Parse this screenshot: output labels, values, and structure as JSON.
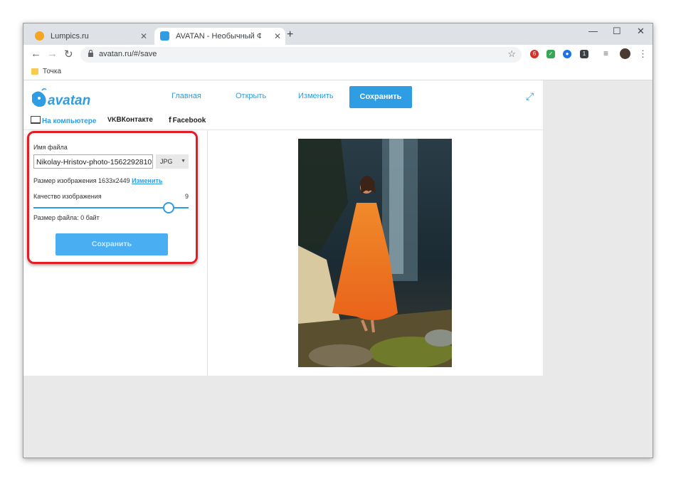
{
  "browser": {
    "tabs": [
      {
        "title": "Lumpics.ru",
        "favicon_color": "#f4a623",
        "close": "✕"
      },
      {
        "title": "AVATAN - Необычный Фоторедактор",
        "favicon_color": "#2e9de3",
        "close": "✕"
      }
    ],
    "new_tab": "+",
    "window_controls": {
      "minimize": "—",
      "maximize": "☐",
      "close": "✕"
    },
    "nav": {
      "back": "←",
      "forward": "→",
      "reload": "↻"
    },
    "address": {
      "url": "avatan.ru/#/save",
      "lock": "🔒",
      "star": "☆"
    },
    "extensions": [
      {
        "icon": "opera-icon",
        "color": "#d93025",
        "badge": "6"
      },
      {
        "icon": "check-icon",
        "color": "#34a853",
        "badge": "✓"
      },
      {
        "icon": "vpn-icon",
        "color": "#1a73e8",
        "badge": "●"
      },
      {
        "icon": "shield-icon",
        "color": "#3c4043",
        "badge": "1"
      }
    ],
    "menu": "⋮",
    "bookmarks": [
      {
        "label": "Точка",
        "icon": "folder-icon"
      }
    ]
  },
  "app": {
    "logo": "avatan",
    "nav": {
      "home": "Главная",
      "open": "Открыть",
      "edit": "Изменить",
      "save": "Сохранить"
    },
    "destinations": {
      "pc": "На компьютере",
      "vk": "ВКонтакте",
      "fb": "Facebook"
    },
    "save_panel": {
      "file_name_label": "Имя файла",
      "file_name_value": "Nikolay-Hristov-photo-1562292810",
      "format": "JPG",
      "image_size_label": "Размер изображения 1633x2449",
      "change_link": "Изменить",
      "quality_label": "Качество изображения",
      "quality_value": "9",
      "quality_fraction": 0.9,
      "file_size_label": "Размер файла: 0 байт",
      "save_button": "Сохранить"
    },
    "colors": {
      "accent": "#2e9de3",
      "highlight_border": "#e51c23"
    }
  }
}
